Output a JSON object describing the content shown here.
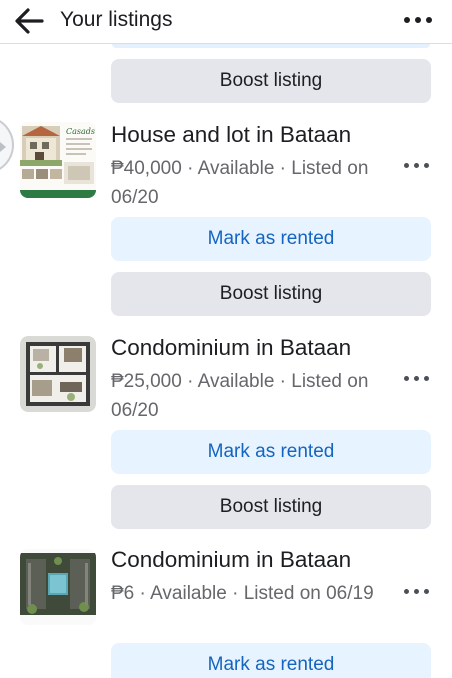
{
  "header": {
    "title": "Your listings"
  },
  "listings": [
    {
      "title": "House and lot in Bataan",
      "meta": "₱40,000 · Available · Listed on 06/20",
      "rent_label": "Mark as rented",
      "boost_label": "Boost listing"
    },
    {
      "title": "Condominium in Bataan",
      "meta": "₱25,000 · Available · Listed on 06/20",
      "rent_label": "Mark as rented",
      "boost_label": "Boost listing"
    },
    {
      "title": "Condominium in Bataan",
      "meta": "₱6 · Available · Listed on 06/19",
      "rent_label": "Mark as rented"
    }
  ],
  "top_boost_label": "Boost listing",
  "thumb1": {
    "brand": "Casads"
  },
  "colors": {
    "accent": "#1565c0",
    "rent_bg": "#e7f3ff",
    "boost_bg": "#e4e6eb"
  }
}
